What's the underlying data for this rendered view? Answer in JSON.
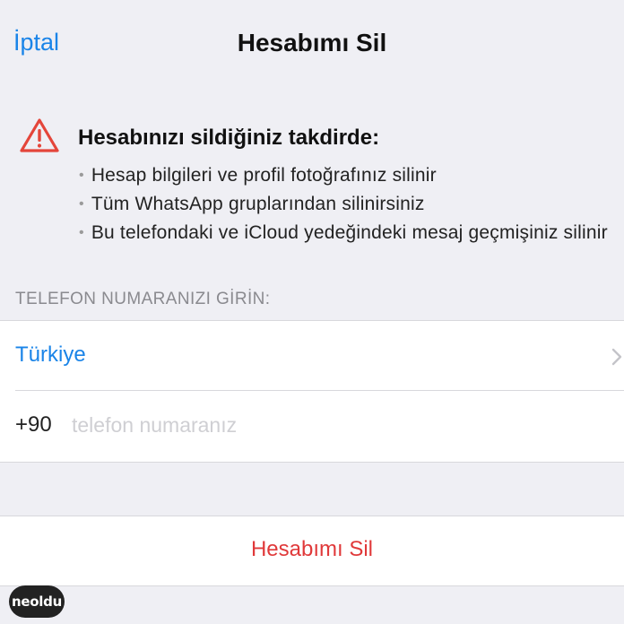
{
  "nav": {
    "cancel_label": "İptal",
    "title": "Hesabımı Sil"
  },
  "warning": {
    "icon": "warning-triangle-icon",
    "heading": "Hesabınızı sildiğiniz takdirde:",
    "bullets": [
      "Hesap bilgileri ve profil fotoğrafınız silinir",
      "Tüm WhatsApp gruplarından silinirsiniz",
      "Bu telefondaki ve iCloud yedeğindeki mesaj geçmişiniz silinir"
    ]
  },
  "phone_section": {
    "header": "TELEFON NUMARANIZI GİRİN:",
    "country": "Türkiye",
    "country_code": "+90",
    "phone_placeholder": "telefon numaranız",
    "phone_value": ""
  },
  "delete_button_label": "Hesabımı Sil",
  "watermark": "neoldu",
  "colors": {
    "accent": "#1a84e8",
    "destructive": "#e0393a",
    "background": "#efeff4",
    "warning_icon": "#e4453a"
  }
}
